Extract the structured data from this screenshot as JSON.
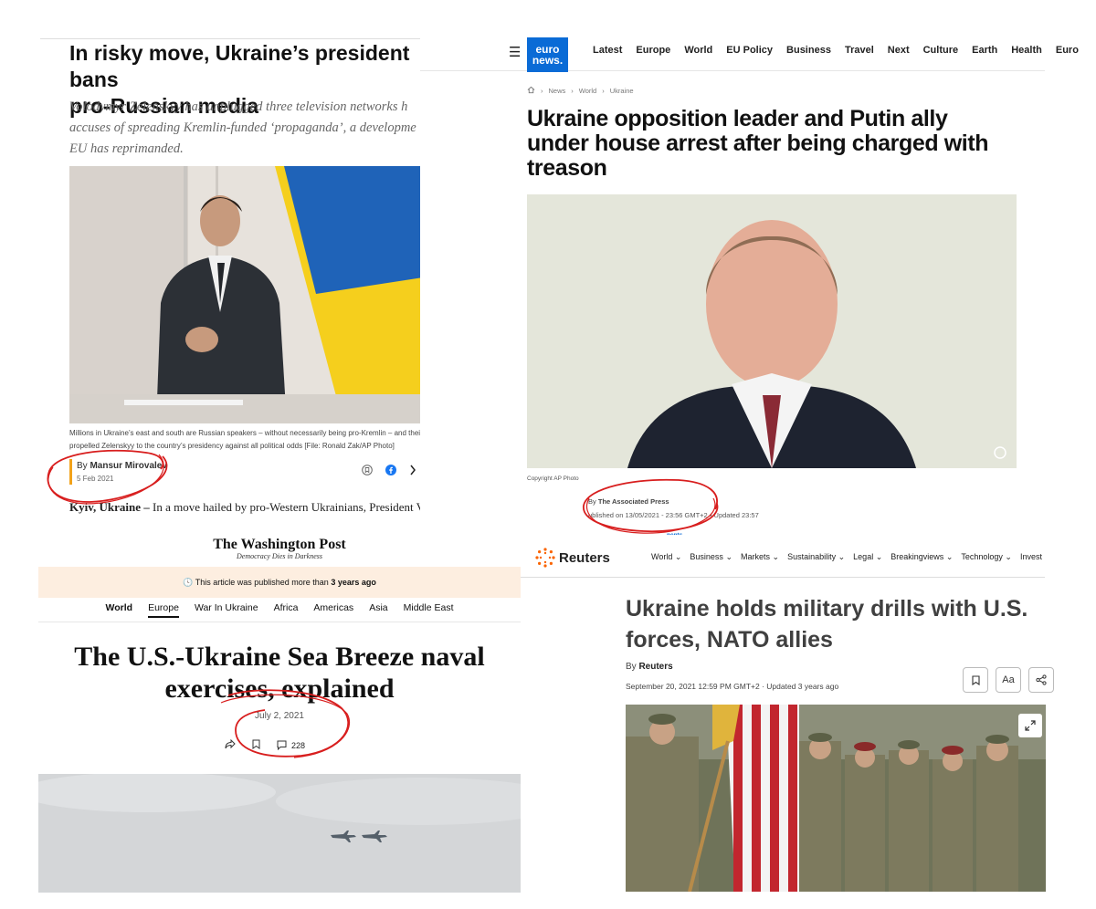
{
  "aljazeera": {
    "headline": "In risky move, Ukraine’s president bans\npro-Russian media",
    "standfirst": "Volodymyr Zelenskyy has unplugged three television networks h\naccuses of spreading Kremlin-funded ‘propaganda’, a developme\nEU has reprimanded.",
    "caption": "Millions in Ukraine’s east and south are Russian speakers – without necessarily being pro-Kremlin – and their vot\npropelled Zelenskyy to the country’s presidency against all political odds [File: Ronald Zak/AP Photo]",
    "by_prefix": "By",
    "author": "Mansur Mirovalev",
    "date": "5 Feb 2021",
    "lede_dateline": "Kyiv, Ukraine –",
    "lede_text": " In a move hailed by pro-Western Ukrainians, President Volo",
    "icons": [
      "bookmark-icon",
      "facebook-icon",
      "more-icon"
    ]
  },
  "euronews": {
    "logo": "euro\nnews.",
    "nav": [
      "Latest",
      "Europe",
      "World",
      "EU Policy",
      "Business",
      "Travel",
      "Next",
      "Culture",
      "Earth",
      "Health",
      "Euro"
    ],
    "breadcrumbs": [
      "News",
      "World",
      "Ukraine"
    ],
    "headline": "Ukraine opposition leader and Putin ally\nunder house arrest after being charged with\ntreason",
    "copyright": "Copyright AP Photo",
    "by_prefix": "By",
    "author": "The Associated Press",
    "published": "ublished on 13/05/2021 - 23:56 GMT+2",
    "updated": "Updated 23:57",
    "tab_fragment": "nents"
  },
  "wapo": {
    "masthead": "The Washington Post",
    "tagline": "Democracy Dies in Darkness",
    "notice_prefix": "This article was published more than",
    "notice_bold": "3 years ago",
    "sections": [
      "World",
      "Europe",
      "War In Ukraine",
      "Africa",
      "Americas",
      "Asia",
      "Middle East"
    ],
    "headline": "The U.S.-Ukraine Sea Breeze naval\nexercises, explained",
    "date": "July 2, 2021",
    "comment_count": "228"
  },
  "reuters": {
    "logo": "Reuters",
    "nav": [
      "World",
      "Business",
      "Markets",
      "Sustainability",
      "Legal",
      "Breakingviews",
      "Technology",
      "Invest"
    ],
    "headline": "Ukraine holds military drills with U.S.\nforces, NATO allies",
    "by_prefix": "By",
    "author": "Reuters",
    "date": "September 20, 2021 12:59 PM GMT+2 · Updated 3 years ago",
    "text_size_label": "Aa"
  },
  "colors": {
    "circle": "#d81e1e",
    "aljazeera_accent": "#f2a21a",
    "euronews_blue": "#0a6bd6",
    "wapo_notice_bg": "#fdeee0",
    "reuters_orange": "#fa6400"
  }
}
